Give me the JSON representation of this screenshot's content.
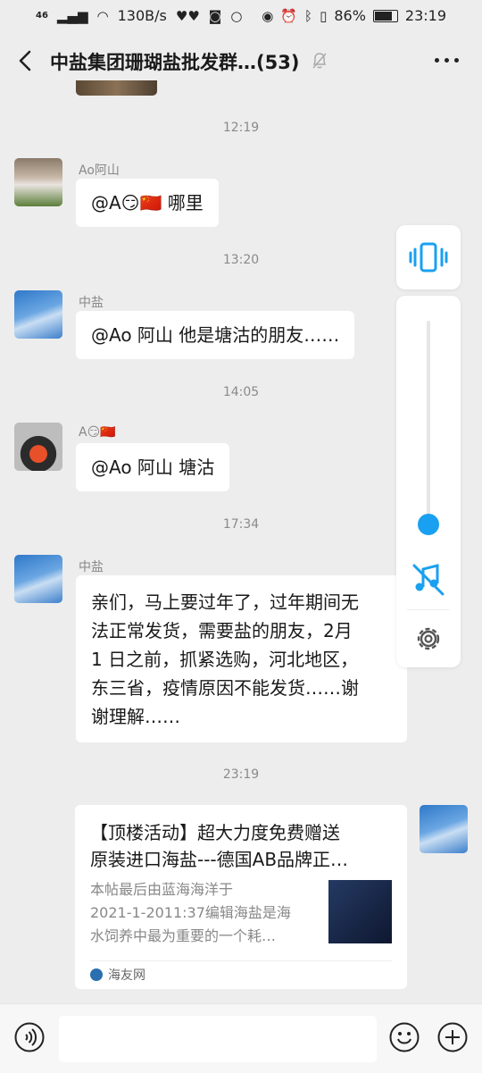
{
  "status": {
    "network": "46",
    "speed": "130B/s",
    "battery": "86%",
    "battery_level": 0.86,
    "time": "23:19"
  },
  "header": {
    "title": "中盐集团珊瑚盐批发群…(53)"
  },
  "messages": [
    {
      "time": "12:19",
      "sender": "Ao阿山",
      "text": "@A😏🇨🇳  哪里"
    },
    {
      "time": "13:20",
      "sender": "中盐",
      "text": "@Ao 阿山  他是塘沽的朋友……"
    },
    {
      "time": "14:05",
      "sender": "A😏🇨🇳",
      "text": "@Ao 阿山  塘沽"
    },
    {
      "time": "17:34",
      "sender": "中盐",
      "lines": [
        "亲们，马上要过年了，过年期间无",
        "法正常发货，需要盐的朋友，2月",
        "1 日之前，抓紧选购，河北地区，",
        "东三省，疫情原因不能发货……谢",
        "谢理解……"
      ]
    }
  ],
  "link_card": {
    "time": "23:19",
    "title_lines": [
      "【顶楼活动】超大力度免费赠送",
      "原装进口海盐---德国AB品牌正…"
    ],
    "desc_lines": [
      "本帖最后由蓝海海洋于",
      "2021-1-2011:37编辑海盐是海",
      "水饲养中最为重要的一个耗…"
    ],
    "source": "海友网"
  },
  "volume": {
    "level": 0.05,
    "mode": "vibrate",
    "vibrate_icon": "vibrate-icon",
    "music_muted_icon": "music-off-icon",
    "settings_icon": "gear-icon"
  },
  "colors": {
    "accent": "#1aa0f0",
    "background": "#ededed"
  }
}
